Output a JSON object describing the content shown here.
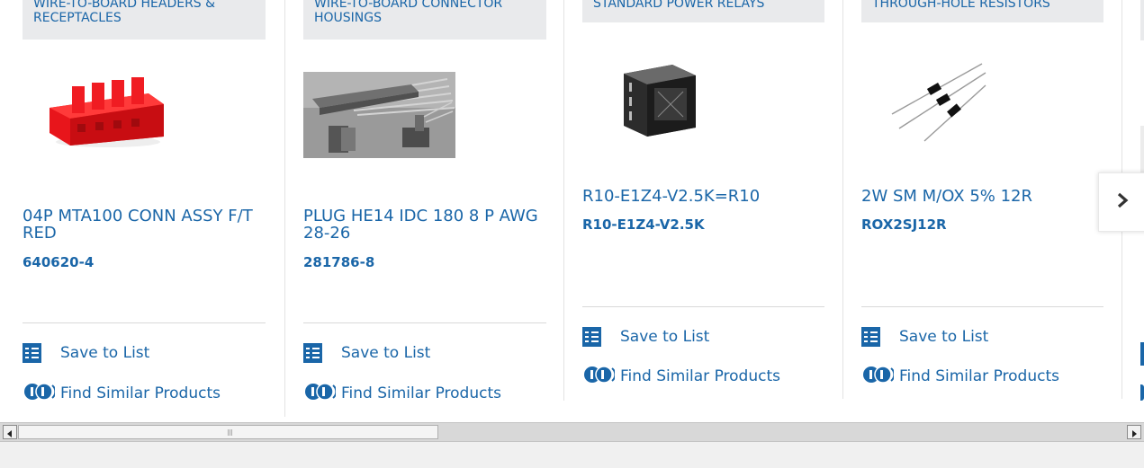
{
  "products": [
    {
      "category": "WIRE-TO-BOARD HEADERS & RECEPTACLES",
      "name": "04P MTA100 CONN ASSY F/T RED",
      "part_number": "640620-4",
      "image": "red-connector-image"
    },
    {
      "category": "WIRE-TO-BOARD CONNECTOR HOUSINGS",
      "name": "PLUG HE14 IDC 180 8 P AWG 28-26",
      "part_number": "281786-8",
      "image": "idc-plug-image"
    },
    {
      "category": "STANDARD POWER RELAYS",
      "name": "R10-E1Z4-V2.5K=R10",
      "part_number": "R10-E1Z4-V2.5K",
      "image": "relay-image"
    },
    {
      "category": "THROUGH-HOLE RESISTORS",
      "name": "2W SM M/OX 5% 12R",
      "part_number": "ROX2SJ12R",
      "image": "resistor-image"
    }
  ],
  "actions": {
    "save_label": "Save to List",
    "similar_label": "Find Similar Products"
  },
  "carousel": {
    "next_icon": "chevron-right-icon"
  },
  "colors": {
    "link": "#1a66a8",
    "category_bg": "#e9eaec",
    "connector_red": "#e8151b"
  }
}
